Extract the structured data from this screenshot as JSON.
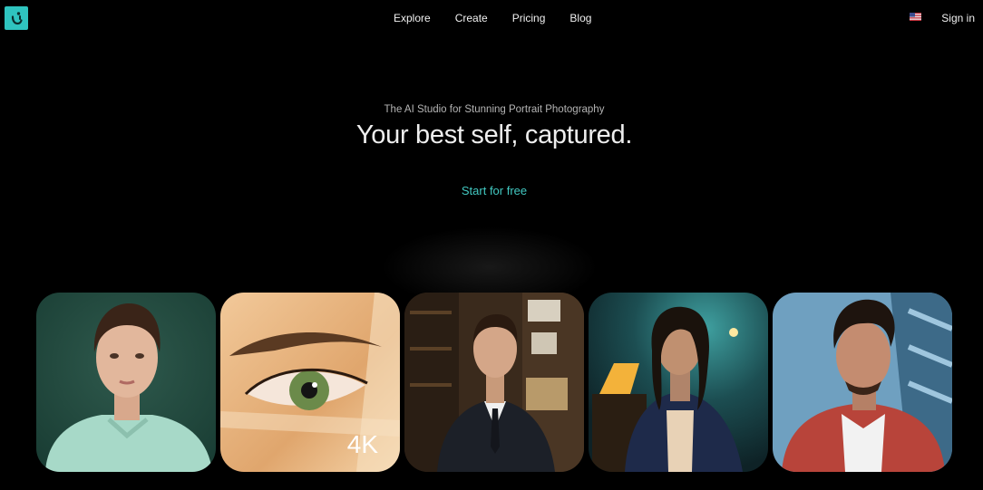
{
  "header": {
    "logo_icon": "smile-logo-icon",
    "nav": [
      "Explore",
      "Create",
      "Pricing",
      "Blog"
    ],
    "flag_icon": "us-flag-icon",
    "signin_label": "Sign in"
  },
  "hero": {
    "tagline": "The AI Studio for Stunning Portrait Photography",
    "headline": "Your best self, captured.",
    "cta_label": "Start for free"
  },
  "gallery": {
    "badge": "4K"
  },
  "colors": {
    "background": "#000000",
    "accent": "#2fc4bf",
    "cta_text": "#42c9c2"
  }
}
